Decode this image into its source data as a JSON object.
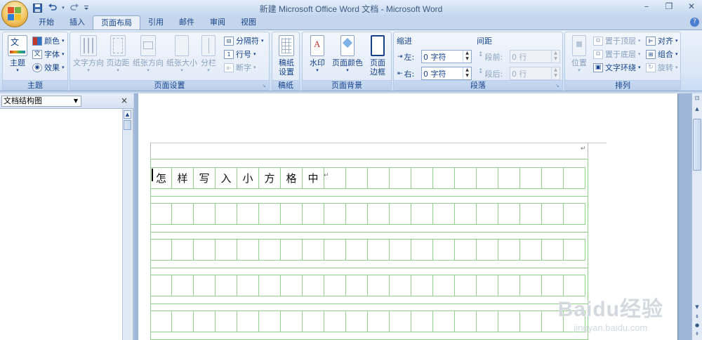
{
  "window": {
    "title": "新建 Microsoft Office Word 文档 - Microsoft Word"
  },
  "quick_access": {
    "save_icon": "save-icon",
    "undo_icon": "undo-icon",
    "redo_icon": "redo-icon",
    "customize_icon": "chevron-down-icon"
  },
  "window_controls": {
    "minimize": "–",
    "restore": "❐",
    "close": "✕"
  },
  "tabs": [
    {
      "label": "开始"
    },
    {
      "label": "插入"
    },
    {
      "label": "页面布局"
    },
    {
      "label": "引用"
    },
    {
      "label": "邮件"
    },
    {
      "label": "审阅"
    },
    {
      "label": "视图"
    }
  ],
  "ribbon": {
    "theme": {
      "group_label": "主题",
      "theme_btn": "主题",
      "colors": "颜色",
      "fonts": "字体",
      "effects": "效果"
    },
    "page_setup": {
      "group_label": "页面设置",
      "text_direction": "文字方向",
      "margins": "页边距",
      "orientation": "纸张方向",
      "size": "纸张大小",
      "columns": "分栏",
      "breaks": "分隔符",
      "line_numbers": "行号",
      "hyphenation": "断字"
    },
    "manuscript": {
      "group_label": "稿纸",
      "setup_line1": "稿纸",
      "setup_line2": "设置"
    },
    "page_background": {
      "group_label": "页面背景",
      "watermark": "水印",
      "page_color": "页面颜色",
      "borders_line1": "页面",
      "borders_line2": "边框"
    },
    "paragraph": {
      "group_label": "段落",
      "indent_title": "缩进",
      "spacing_title": "间距",
      "left_label": "左:",
      "right_label": "右:",
      "left_value": "0 字符",
      "right_value": "0 字符",
      "before_label": "段前:",
      "after_label": "段后:",
      "before_value": "0 行",
      "after_value": "0 行"
    },
    "arrange": {
      "group_label": "排列",
      "position": "位置",
      "bring_front": "置于顶层",
      "send_back": "置于底层",
      "text_wrap": "文字环绕",
      "align": "对齐",
      "group": "组合",
      "rotate": "旋转"
    }
  },
  "nav_pane": {
    "view_select": "文档结构图",
    "close": "×"
  },
  "document": {
    "grid_cols": 20,
    "grid_rows": 5,
    "first_row_text": [
      "怎",
      "样",
      "写",
      "入",
      "小",
      "方",
      "格",
      "中"
    ],
    "paragraph_mark": "↵"
  },
  "watermark": {
    "line1": "Baidu经验",
    "line2": "jingyan.baidu.com"
  }
}
